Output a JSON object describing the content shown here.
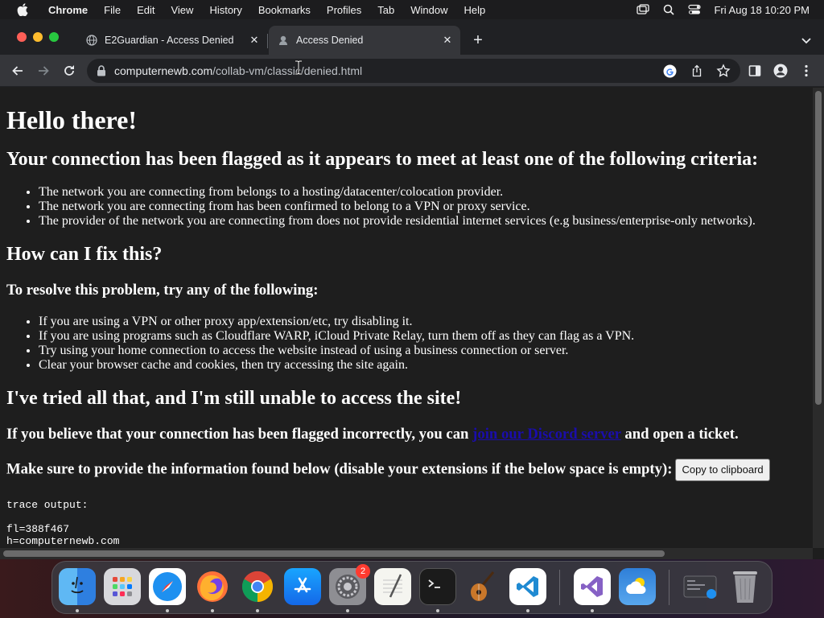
{
  "menubar": {
    "app_name": "Chrome",
    "items": [
      "File",
      "Edit",
      "View",
      "History",
      "Bookmarks",
      "Profiles",
      "Tab",
      "Window",
      "Help"
    ],
    "clock": "Fri Aug 18  10:20 PM"
  },
  "tabs": [
    {
      "title": "E2Guardian - Access Denied",
      "favicon": "globe-icon",
      "active": false
    },
    {
      "title": "Access Denied",
      "favicon": "page-icon",
      "active": true
    }
  ],
  "omnibox": {
    "host": "computernewb.com",
    "path": "/collab-vm/classic/denied.html"
  },
  "page": {
    "heading": "Hello there!",
    "criteria_heading": "Your connection has been flagged as it appears to meet at least one of the following criteria:",
    "criteria": [
      "The network you are connecting from belongs to a hosting/datacenter/colocation provider.",
      "The network you are connecting from has been confirmed to belong to a VPN or proxy service.",
      "The provider of the network you are connecting from does not provide residential internet services (e.g business/enterprise-only networks)."
    ],
    "fix_heading": "How can I fix this?",
    "resolve_heading": "To resolve this problem, try any of the following:",
    "fixes": [
      "If you are using a VPN or other proxy app/extension/etc, try disabling it.",
      "If you are using programs such as Cloudflare WARP, iCloud Private Relay, turn them off as they can flag as a VPN.",
      "Try using your home connection to access the website instead of using a business connection or server.",
      "Clear your browser cache and cookies, then try accessing the site again."
    ],
    "tried_heading": "I've tried all that, and I'm still unable to access the site!",
    "incorrect_prefix": "If you believe that your connection has been flagged incorrectly, you can ",
    "discord_link": "join our Discord server",
    "incorrect_suffix": " and open a ticket.",
    "info_text": "Make sure to provide the information found below (disable your extensions if the below space is empty):",
    "copy_button": "Copy to clipboard",
    "trace_label": "trace output:",
    "trace_lines": [
      "fl=388f467",
      "h=computernewb.com"
    ]
  },
  "dock": {
    "apps": [
      "finder-icon",
      "launchpad-icon",
      "safari-icon",
      "firefox-icon",
      "chrome-icon",
      "app-store-icon",
      "system-settings-icon",
      "textedit-icon",
      "terminal-icon",
      "garageband-icon",
      "vscode-icon",
      "visual-studio-icon",
      "weather-icon",
      "downloads-stack-icon",
      "trash-icon"
    ],
    "settings_badge": "2"
  }
}
